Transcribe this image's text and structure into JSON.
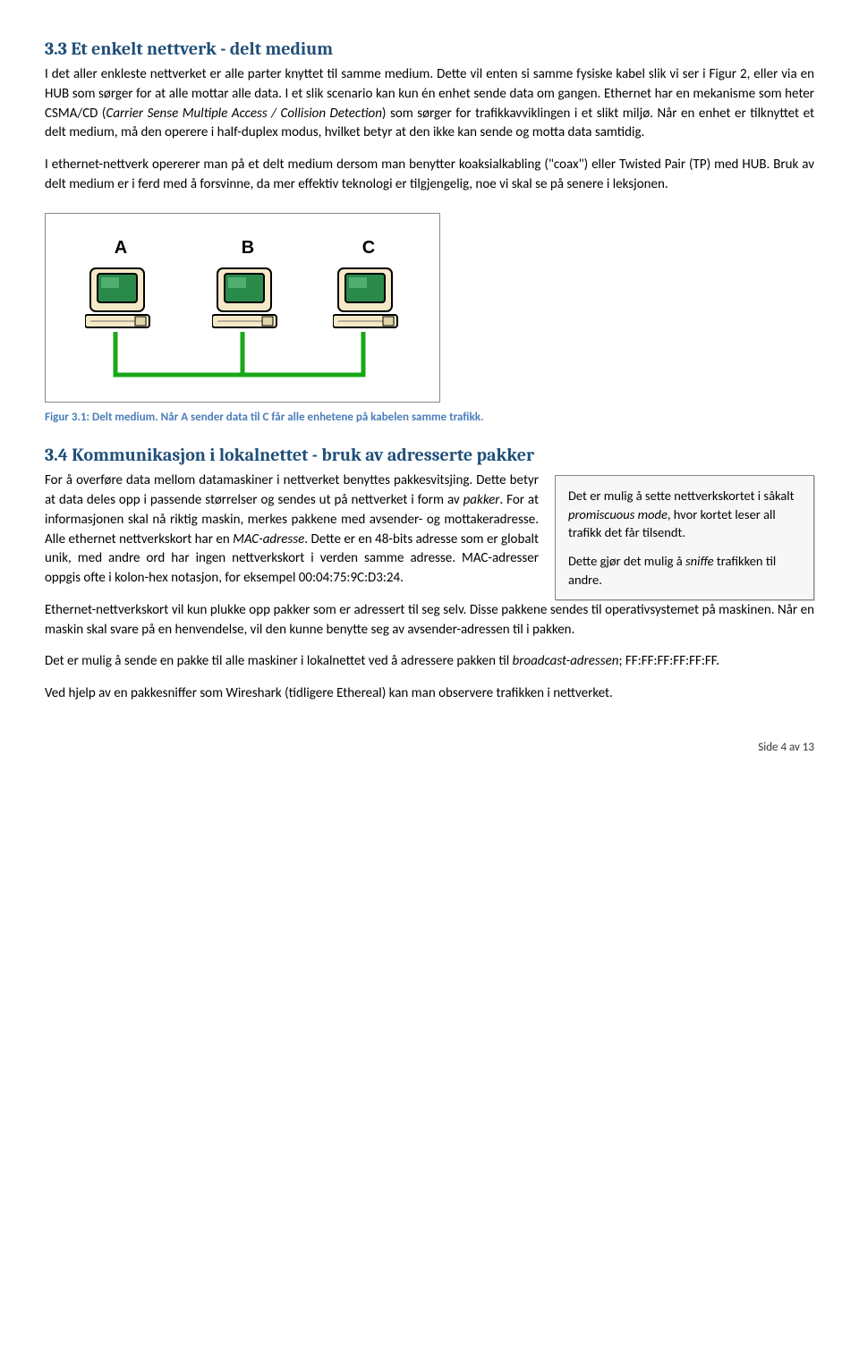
{
  "section33": {
    "heading": "3.3  Et enkelt nettverk - delt medium",
    "p1": "I det aller enkleste nettverket er alle parter knyttet til samme medium. Dette vil enten si samme fysiske kabel slik vi ser i Figur 2, eller via en HUB som sørger for at alle mottar alle data. I et slik scenario kan kun én enhet sende data om gangen. Ethernet har en mekanisme som heter CSMA/CD (",
    "p1_em": "Carrier Sense Multiple Access / Collision Detection",
    "p1_tail": ") som sørger for trafikkavviklingen i et slikt miljø. Når en enhet er tilknyttet et delt medium, må den operere i half-duplex modus, hvilket betyr at den ikke kan sende og motta data samtidig.",
    "p2": "I ethernet-nettverk opererer man på et delt medium dersom man benytter koaksialkabling (\"coax\") eller Twisted Pair (TP) med HUB. Bruk av delt medium er i ferd med å forsvinne, da mer effektiv teknologi er tilgjengelig, noe vi skal se på senere i leksjonen."
  },
  "diagram": {
    "label_a": "A",
    "label_b": "B",
    "label_c": "C"
  },
  "fig_caption": "Figur 3.1: Delt medium. Når A sender data til C får alle enhetene på kabelen samme trafikk.",
  "section34": {
    "heading": "3.4  Kommunikasjon i lokalnettet - bruk av adresserte pakker",
    "p1a": "For å overføre data mellom datamaskiner i nettverket benyttes pakkesvitsjing. Dette betyr at data deles opp i passende størrelser og sendes ut på nettverket i form av ",
    "p1a_em": "pakker",
    "p1a_mid": ". For at informasjonen skal nå riktig maskin, merkes pakkene med avsender- og mottakeradresse. Alle ethernet nettverkskort har en ",
    "p1a_em2": "MAC-adresse",
    "p1a_tail": ". Dette er en 48-bits adresse som er globalt unik, med andre ord har ingen nettverkskort i verden samme adresse. MAC-adresser oppgis ofte i kolon-hex notasjon, for eksempel 00:04:75:9C:D3:24.",
    "p2": "Ethernet-nettverkskort vil kun plukke opp pakker som er adressert til seg selv. Disse pakkene sendes til operativsystemet på maskinen. Når en maskin skal svare på en henvendelse, vil den kunne benytte seg av avsender-adressen til i pakken.",
    "p3a": "Det er mulig å sende en pakke til alle maskiner i lokalnettet ved å adressere pakken til ",
    "p3_em": "broadcast-adressen",
    "p3_tail": "; FF:FF:FF:FF:FF:FF.",
    "p4": "Ved hjelp av en pakkesniffer som Wireshark (tidligere Ethereal) kan man observere trafikken i nettverket."
  },
  "callout": {
    "p1a": "Det er mulig å sette nettverkskortet i såkalt ",
    "p1_em": "promiscuous mode",
    "p1_tail": ", hvor kortet leser all trafikk det får tilsendt.",
    "p2a": "Dette gjør det mulig å ",
    "p2_em": "sniffe",
    "p2_tail": " trafikken til andre."
  },
  "footer": "Side 4 av 13"
}
